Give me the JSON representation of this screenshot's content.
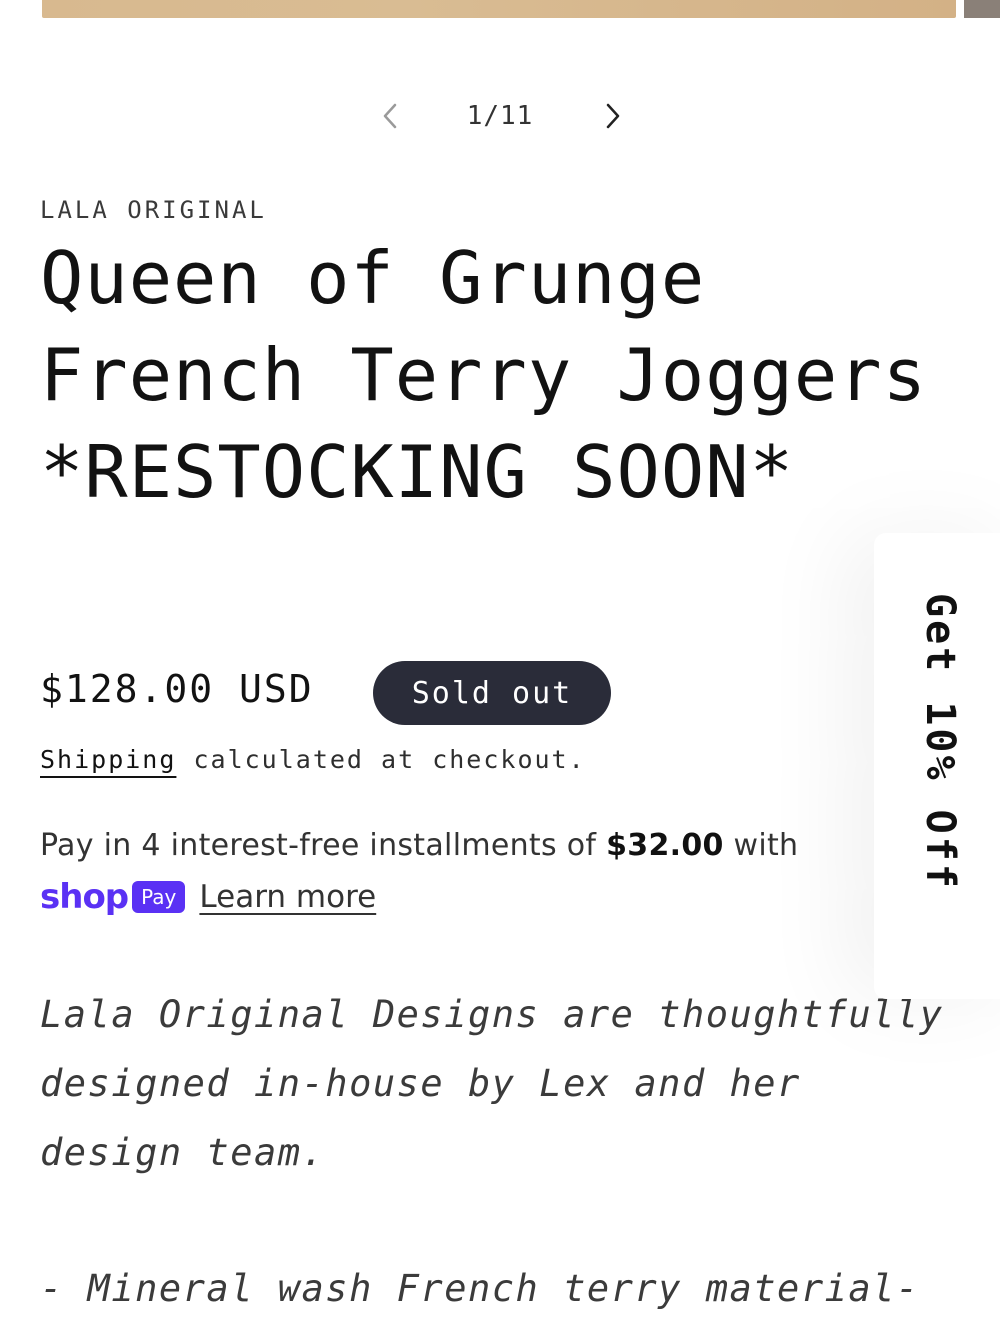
{
  "pager": {
    "counter": "1/11"
  },
  "product": {
    "vendor": "LALA ORIGINAL",
    "title": "Queen of Grunge French Terry Joggers *RESTOCKING SOON*",
    "price": "$128.00 USD",
    "badge": "Sold out",
    "shipping_link": "Shipping",
    "shipping_rest": " calculated at checkout."
  },
  "installments": {
    "prefix": "Pay in 4 interest-free installments of ",
    "amount": "$32.00",
    "suffix": " with",
    "shop_logo": "shop",
    "pay_label": "Pay",
    "learn_more": "Learn more"
  },
  "description": {
    "intro": "Lala Original Designs are thoughtfully designed in-house by Lex and her design team.",
    "bullet_1": "- Mineral wash French terry material-"
  },
  "discount_tab": {
    "label": "Get 10% Off"
  },
  "icons": {
    "prev": "chevron-left-icon",
    "next": "chevron-right-icon"
  },
  "colors": {
    "badge_bg": "#2a2c39",
    "shop_pay": "#5a31f4"
  }
}
